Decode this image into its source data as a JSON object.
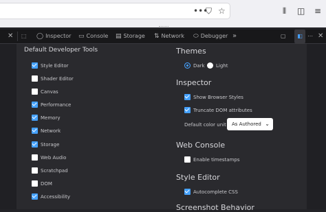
{
  "browser": {
    "urlbar_value": "",
    "url_icons": [
      "more-dots-icon",
      "pocket-icon",
      "bookmark-star-icon"
    ],
    "toolbar_icons": [
      "library-icon",
      "sidebar-icon",
      "menu-icon"
    ]
  },
  "devtools": {
    "toolbar": {
      "tabs": [
        {
          "label": "Inspector",
          "icon": "inspector-icon"
        },
        {
          "label": "Console",
          "icon": "console-icon"
        },
        {
          "label": "Storage",
          "icon": "storage-icon"
        },
        {
          "label": "Network",
          "icon": "network-icon"
        },
        {
          "label": "Debugger",
          "icon": "debugger-icon"
        }
      ],
      "overflow": "»"
    },
    "settings": {
      "default_tools": {
        "title": "Default Developer Tools",
        "items": [
          {
            "label": "Style Editor",
            "checked": true
          },
          {
            "label": "Shader Editor",
            "checked": false
          },
          {
            "label": "Canvas",
            "checked": false
          },
          {
            "label": "Performance",
            "checked": true
          },
          {
            "label": "Memory",
            "checked": true
          },
          {
            "label": "Network",
            "checked": true
          },
          {
            "label": "Storage",
            "checked": true
          },
          {
            "label": "Web Audio",
            "checked": false
          },
          {
            "label": "Scratchpad",
            "checked": false
          },
          {
            "label": "DOM",
            "checked": false
          },
          {
            "label": "Accessibility",
            "checked": true
          }
        ]
      },
      "themes": {
        "title": "Themes",
        "options": [
          {
            "label": "Dark",
            "selected": true
          },
          {
            "label": "Light",
            "selected": false
          }
        ]
      },
      "inspector": {
        "title": "Inspector",
        "show_browser_styles": "Show Browser Styles",
        "truncate_dom": "Truncate DOM attributes",
        "color_unit_label": "Default color unit",
        "color_unit_value": "As Authored"
      },
      "web_console": {
        "title": "Web Console",
        "enable_timestamps": "Enable timestamps"
      },
      "style_editor": {
        "title": "Style Editor",
        "autocomplete_css": "Autocomplete CSS"
      },
      "screenshot": {
        "title": "Screenshot Behavior"
      }
    }
  },
  "colors": {
    "accent": "#45a1ff",
    "panel_bg": "#2a2a2e",
    "toolbar_bg": "#18181a"
  }
}
